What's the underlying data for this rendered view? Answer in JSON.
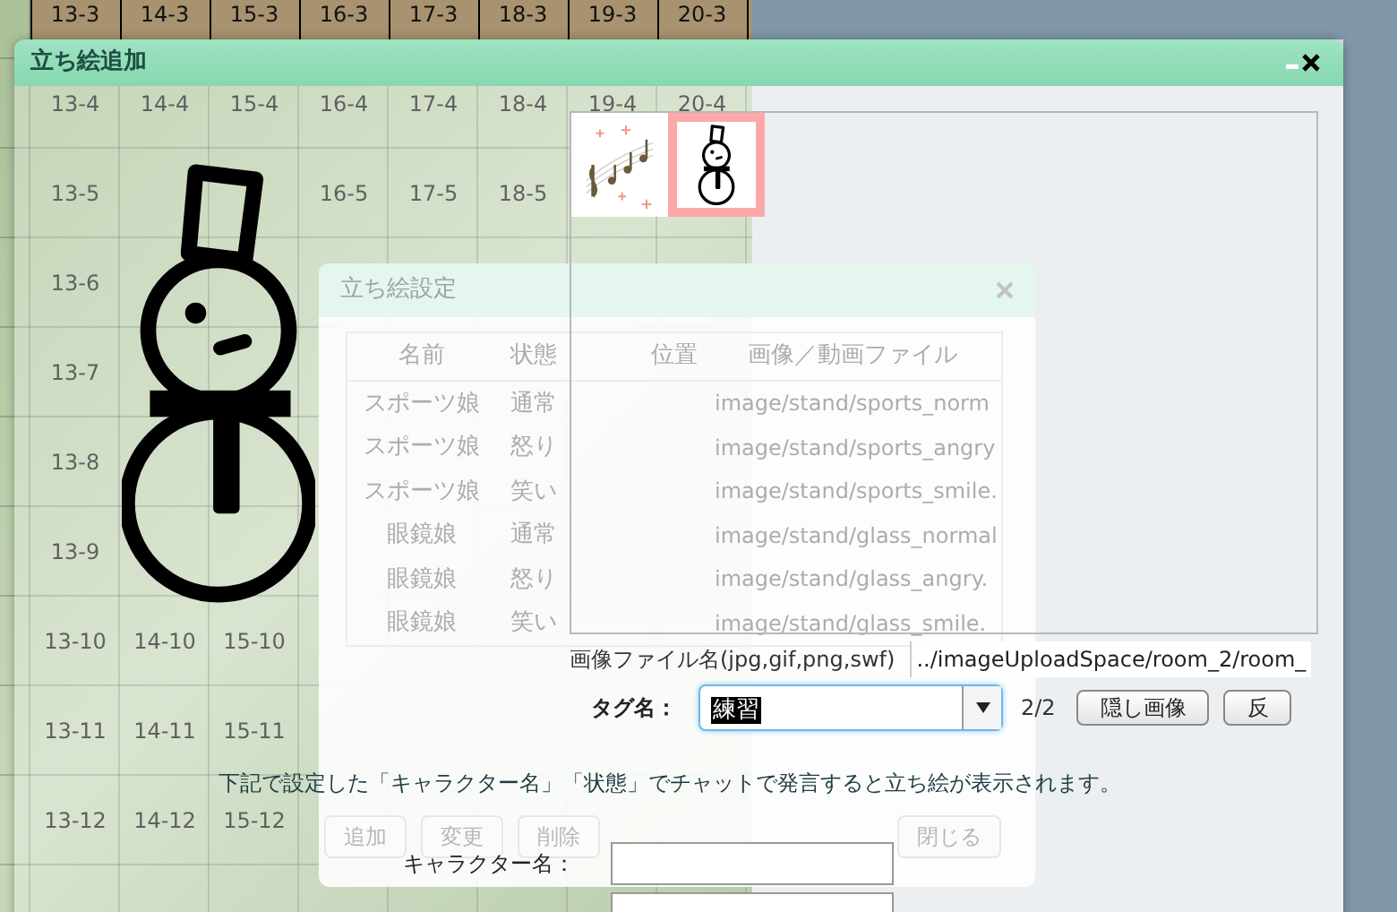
{
  "map": {
    "rows": [
      {
        "cells": [
          {
            "label": "13-3"
          },
          {
            "label": "14-3"
          },
          {
            "label": "15-3"
          },
          {
            "label": "16-3"
          },
          {
            "label": "17-3"
          },
          {
            "label": "18-3"
          },
          {
            "label": "19-3"
          },
          {
            "label": "20-3"
          }
        ]
      },
      {
        "cells": [
          {
            "label": "13-4"
          },
          {
            "label": "14-4"
          },
          {
            "label": "15-4"
          },
          {
            "label": "16-4"
          },
          {
            "label": "17-4"
          },
          {
            "label": "18-4"
          },
          {
            "label": "19-4"
          },
          {
            "label": "20-4"
          }
        ]
      },
      {
        "cells": [
          {
            "label": "13-5"
          },
          {},
          {},
          {
            "label": "16-5"
          },
          {
            "label": "17-5"
          },
          {
            "label": "18-5"
          },
          {},
          {}
        ]
      },
      {
        "cells": [
          {
            "label": "13-6"
          },
          {},
          {},
          {},
          {},
          {},
          {},
          {}
        ]
      },
      {
        "cells": [
          {
            "label": "13-7"
          },
          {},
          {},
          {},
          {},
          {},
          {},
          {}
        ]
      },
      {
        "cells": [
          {
            "label": "13-8"
          },
          {},
          {},
          {},
          {},
          {},
          {},
          {}
        ]
      },
      {
        "cells": [
          {
            "label": "13-9"
          },
          {},
          {},
          {},
          {},
          {},
          {},
          {}
        ]
      },
      {
        "cells": [
          {
            "label": "13-10"
          },
          {
            "label": "14-10"
          },
          {
            "label": "15-10"
          },
          {},
          {},
          {},
          {},
          {}
        ]
      },
      {
        "cells": [
          {
            "label": "13-11"
          },
          {
            "label": "14-11"
          },
          {
            "label": "15-11"
          },
          {},
          {},
          {},
          {},
          {}
        ]
      },
      {
        "cells": [
          {
            "label": "13-12"
          },
          {
            "label": "14-12"
          },
          {
            "label": "15-12"
          },
          {},
          {},
          {},
          {},
          {}
        ]
      }
    ]
  },
  "background_dialog": {
    "title": "立ち絵設定",
    "columns": [
      "名前",
      "状態",
      "位置",
      "画像／動画ファイル"
    ],
    "rows": [
      {
        "name": "スポーツ娘",
        "state": "通常",
        "file": "image/stand/sports_norm"
      },
      {
        "name": "スポーツ娘",
        "state": "怒り",
        "file": "image/stand/sports_angry"
      },
      {
        "name": "スポーツ娘",
        "state": "笑い",
        "file": "image/stand/sports_smile."
      },
      {
        "name": "眼鏡娘",
        "state": "通常",
        "file": "image/stand/glass_normal"
      },
      {
        "name": "眼鏡娘",
        "state": "怒り",
        "file": "image/stand/glass_angry."
      },
      {
        "name": "眼鏡娘",
        "state": "笑い",
        "file": "image/stand/glass_smile."
      }
    ],
    "buttons": [
      "追加",
      "変更",
      "削除"
    ],
    "close_button": "閉じる"
  },
  "dialog": {
    "title": "立ち絵追加",
    "images": [
      {
        "kind": "music",
        "selected": false
      },
      {
        "kind": "snowman",
        "selected": true
      }
    ],
    "file_label": "画像ファイル名(jpg,gif,png,swf)",
    "file_value": "../imageUploadSpace/room_2/room_",
    "tag_label": "タグ名：",
    "tag_value": "練習",
    "tag_count": "2/2",
    "buttons": [
      "隠し画像",
      "反"
    ],
    "note": "下記で設定した「キャラクター名」「状態」でチャットで発言すると立ち絵が表示されます。",
    "character_label": "キャラクター名："
  }
}
